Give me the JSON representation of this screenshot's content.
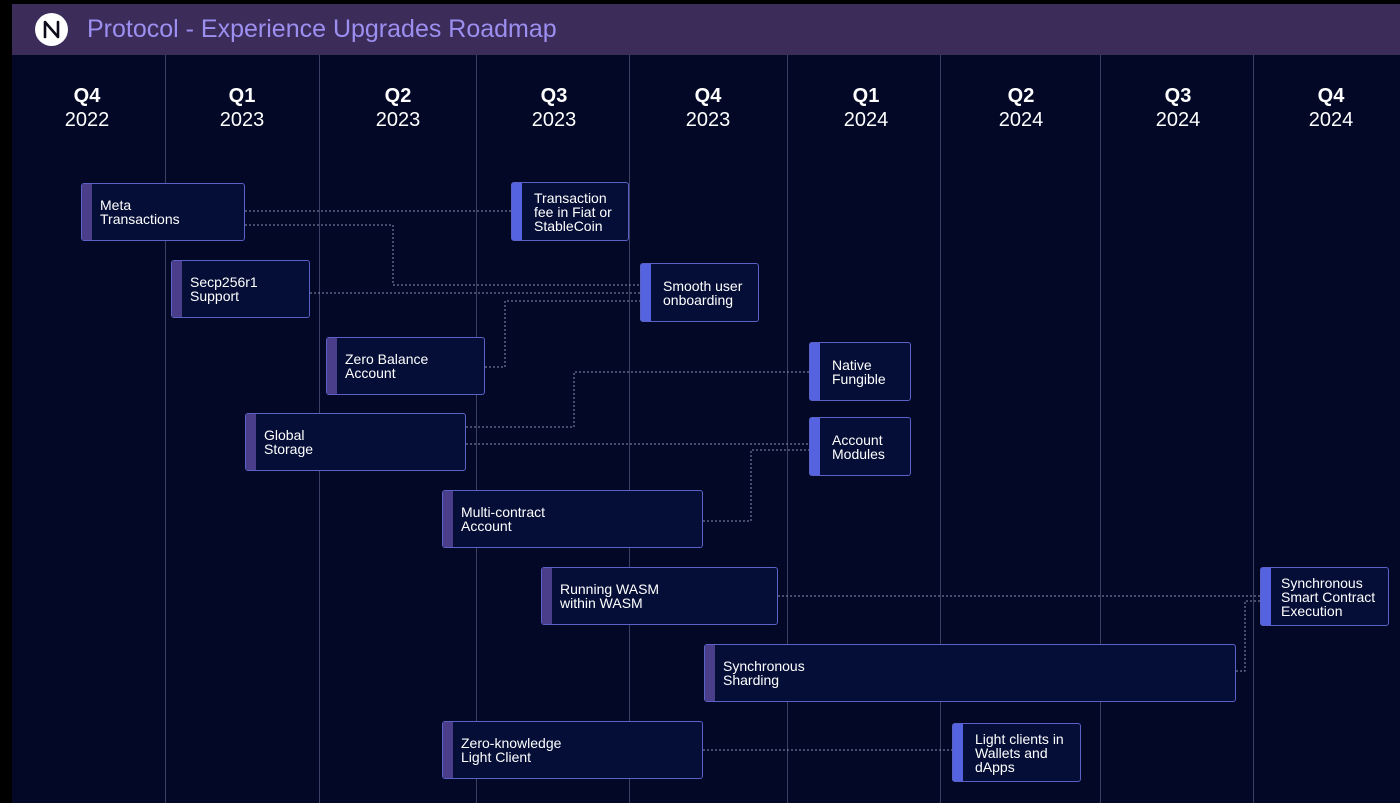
{
  "header": {
    "title": "Protocol - Experience Upgrades Roadmap",
    "logo_icon": "near-logo-icon",
    "background": "#3b2c5a",
    "title_color": "#9d8ff0"
  },
  "timeline": {
    "quarters": [
      {
        "quarter": "Q4",
        "year": "2022"
      },
      {
        "quarter": "Q1",
        "year": "2023"
      },
      {
        "quarter": "Q2",
        "year": "2023"
      },
      {
        "quarter": "Q3",
        "year": "2023"
      },
      {
        "quarter": "Q4",
        "year": "2023"
      },
      {
        "quarter": "Q1",
        "year": "2024"
      },
      {
        "quarter": "Q2",
        "year": "2024"
      },
      {
        "quarter": "Q3",
        "year": "2024"
      },
      {
        "quarter": "Q4",
        "year": "2024"
      }
    ]
  },
  "nodes": [
    {
      "id": "meta-transactions",
      "label": "Meta\nTransactions"
    },
    {
      "id": "secp256r1-support",
      "label": "Secp256r1\nSupport"
    },
    {
      "id": "zero-balance-account",
      "label": "Zero Balance\nAccount"
    },
    {
      "id": "global-storage",
      "label": "Global\nStorage"
    },
    {
      "id": "multi-contract-account",
      "label": "Multi-contract\nAccount"
    },
    {
      "id": "running-wasm-within-wasm",
      "label": "Running WASM\nwithin WASM"
    },
    {
      "id": "synchronous-sharding",
      "label": "Synchronous\nSharding"
    },
    {
      "id": "zero-knowledge-light-client",
      "label": "Zero-knowledge\nLight Client"
    },
    {
      "id": "transaction-fee-fiat",
      "label": "Transaction\nfee in Fiat or\nStableCoin"
    },
    {
      "id": "smooth-user-onboarding",
      "label": "Smooth user\nonboarding"
    },
    {
      "id": "native-fungible",
      "label": "Native\nFungible"
    },
    {
      "id": "account-modules",
      "label": "Account\nModules"
    },
    {
      "id": "synchronous-smart-contract-execution",
      "label": "Synchronous\nSmart Contract\nExecution"
    },
    {
      "id": "light-clients-wallets",
      "label": "Light clients  in\nWallets and\ndApps"
    }
  ],
  "links": [
    {
      "from": "meta-transactions",
      "to": "transaction-fee-fiat"
    },
    {
      "from": "meta-transactions",
      "to": "smooth-user-onboarding"
    },
    {
      "from": "secp256r1-support",
      "to": "smooth-user-onboarding"
    },
    {
      "from": "zero-balance-account",
      "to": "smooth-user-onboarding"
    },
    {
      "from": "global-storage",
      "to": "native-fungible"
    },
    {
      "from": "global-storage",
      "to": "account-modules"
    },
    {
      "from": "multi-contract-account",
      "to": "account-modules"
    },
    {
      "from": "running-wasm-within-wasm",
      "to": "synchronous-smart-contract-execution"
    },
    {
      "from": "synchronous-sharding",
      "to": "synchronous-smart-contract-execution"
    },
    {
      "from": "zero-knowledge-light-client",
      "to": "light-clients-wallets"
    }
  ],
  "colors": {
    "background": "#020826",
    "node_fill": "#050e36",
    "node_border": "#5a62c7",
    "accent_prerequisite": "#4a3d8a",
    "accent_outcome": "#5563e0",
    "link": "#8a90b8"
  }
}
